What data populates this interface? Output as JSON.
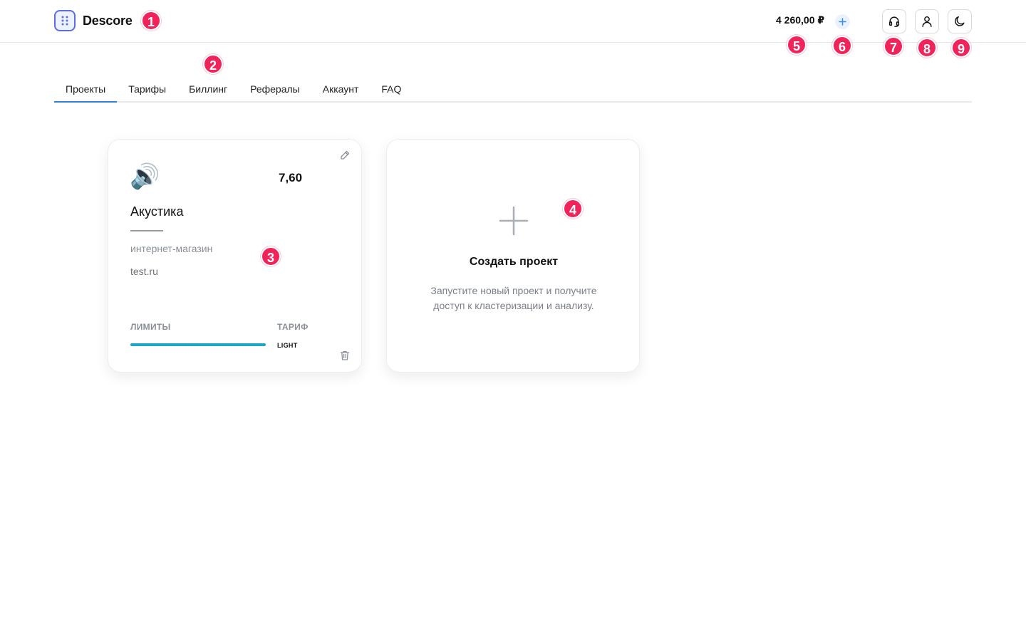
{
  "header": {
    "brand_name": "Descore",
    "balance": "4 260,00 ₽",
    "icons": {
      "logo": "grid-dots-icon",
      "topup": "plus-icon",
      "support": "headset-icon",
      "profile": "user-icon",
      "theme": "moon-icon"
    }
  },
  "tabs": [
    {
      "label": "Проекты",
      "active": true
    },
    {
      "label": "Тарифы",
      "active": false
    },
    {
      "label": "Биллинг",
      "active": false
    },
    {
      "label": "Рефералы",
      "active": false
    },
    {
      "label": "Аккаунт",
      "active": false
    },
    {
      "label": "FAQ",
      "active": false
    }
  ],
  "project_card": {
    "emoji": "🔊",
    "score": "7,60",
    "name": "Акустика",
    "type": "интернет-магазин",
    "site": "test.ru",
    "limits_label": "ЛИМИТЫ",
    "limits_progress": 1.0,
    "tariff_label": "ТАРИФ",
    "tariff_value": "LIGHT",
    "icons": {
      "edit": "edit-pencil-icon",
      "delete": "trash-icon"
    }
  },
  "create_card": {
    "title": "Создать проект",
    "description": "Запустите новый проект и получите доступ к кластеризации и анализу.",
    "icon": "plus-icon"
  },
  "markers": [
    "1",
    "2",
    "3",
    "4",
    "5",
    "6",
    "7",
    "8",
    "9"
  ],
  "colors": {
    "accent": "#2f7fe0",
    "progress": "#1ba6c3",
    "marker": "#f0245a",
    "logo": "#5b6ee1"
  }
}
